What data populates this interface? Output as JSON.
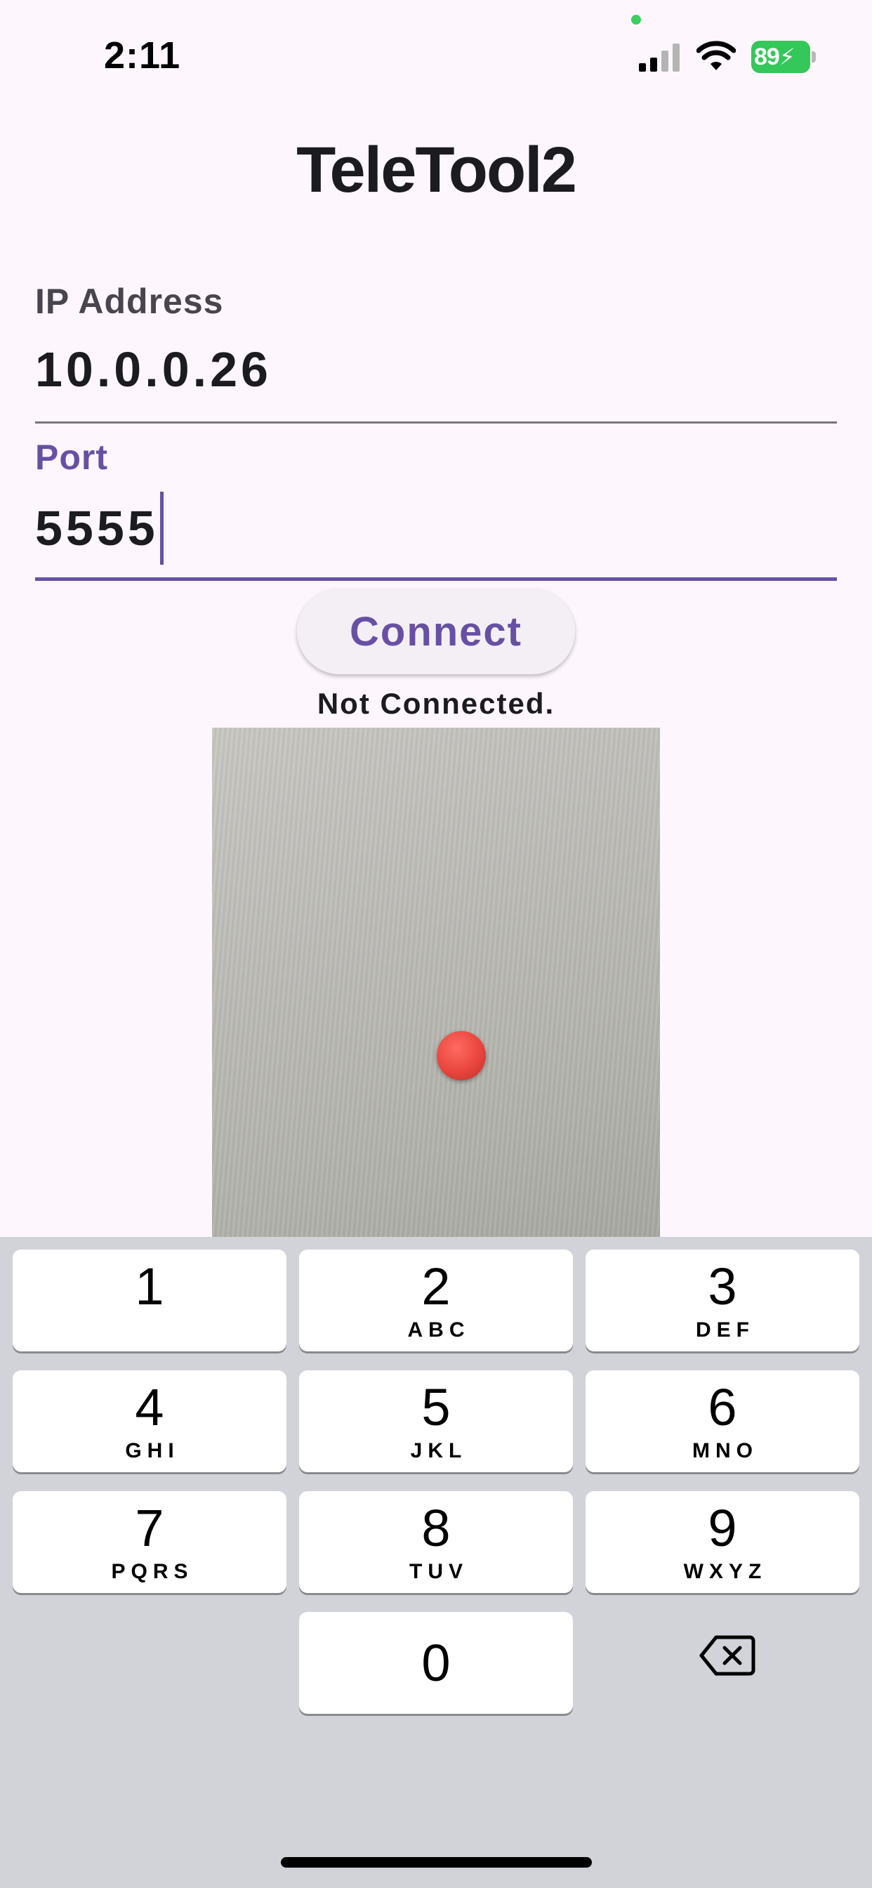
{
  "status_bar": {
    "time": "2:11",
    "battery": "89",
    "icons": [
      "signal-icon",
      "wifi-icon",
      "battery-charging-icon"
    ],
    "colors": {
      "battery": "#34c759",
      "privacy_dot": "#3ccf5f"
    }
  },
  "app": {
    "title": "TeleTool2"
  },
  "form": {
    "ip": {
      "label": "IP Address",
      "value": "10.0.0.26"
    },
    "port": {
      "label": "Port",
      "value": "5555"
    }
  },
  "connect_button": {
    "label": "Connect"
  },
  "status": {
    "text": "Not Connected."
  },
  "keyboard": {
    "keys": [
      {
        "digit": "1",
        "letters": ""
      },
      {
        "digit": "2",
        "letters": "ABC"
      },
      {
        "digit": "3",
        "letters": "DEF"
      },
      {
        "digit": "4",
        "letters": "GHI"
      },
      {
        "digit": "5",
        "letters": "JKL"
      },
      {
        "digit": "6",
        "letters": "MNO"
      },
      {
        "digit": "7",
        "letters": "PQRS"
      },
      {
        "digit": "8",
        "letters": "TUV"
      },
      {
        "digit": "9",
        "letters": "WXYZ"
      },
      {
        "digit": "0",
        "letters": ""
      }
    ],
    "delete_icon": "backspace-icon"
  },
  "theme": {
    "accent": "#6750a4",
    "background": "#fdf7fd",
    "keyboard_bg": "#d1d3d9",
    "marker": "#e8453d"
  }
}
